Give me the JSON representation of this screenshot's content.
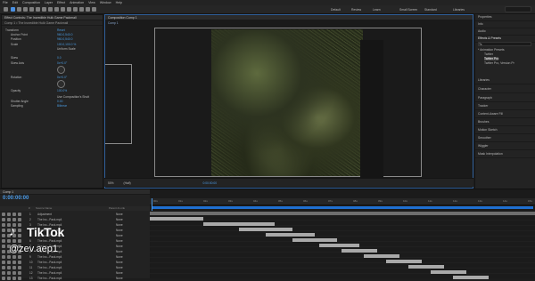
{
  "menu": [
    "File",
    "Edit",
    "Composition",
    "Layer",
    "Effect",
    "Animation",
    "View",
    "Window",
    "Help"
  ],
  "workspaces": [
    "Default",
    "Review",
    "Learn",
    "Small Screen",
    "Standard",
    "Libraries"
  ],
  "effect_controls": {
    "tab": "Effect Controls: The Incredible Hulk Game Packmall",
    "layer": "Comp 1 • The Incredible Hulk Game Packmall",
    "props": [
      {
        "label": "Transform",
        "value": "Reset"
      },
      {
        "label": "Anchor Point",
        "value": "960.0,540.0"
      },
      {
        "label": "Position",
        "value": "960.0,540.0"
      },
      {
        "label": "Scale",
        "value": "100.0,100.0 %"
      },
      {
        "label": "",
        "value": "Uniform Scale"
      },
      {
        "label": "Skew",
        "value": "0.0"
      },
      {
        "label": "Skew Axis",
        "value": "0x+0.0°"
      },
      {
        "label": "Rotation",
        "value": "0x+0.0°"
      },
      {
        "label": "Opacity",
        "value": "100.0%"
      },
      {
        "label": "",
        "value": "Use Composition's Shutt"
      },
      {
        "label": "Shutter Angle",
        "value": "0.00"
      },
      {
        "label": "Sampling",
        "value": "Bilinear"
      }
    ]
  },
  "composition": {
    "tab": "Composition Comp 1",
    "sub_tab": "Comp 1",
    "zoom": "50%",
    "quality": "(Half)",
    "timecode": "0:00:00:00"
  },
  "right_panel": {
    "items": [
      "Properties",
      "Info",
      "Audio",
      "Effects & Presets",
      "Libraries",
      "Character",
      "Paragraph",
      "Tracker",
      "Content-Aware Fill",
      "Brushes",
      "Motion Sketch",
      "Smoother",
      "Wiggler",
      "Mask Interpolation"
    ],
    "search": "Ts",
    "tree": [
      "* Animation Presets",
      "Twitter",
      "Twitter Pro",
      "Twitter Pro, Version Pr"
    ]
  },
  "timeline": {
    "tab": "Comp 1",
    "timecode": "0:00:00:00",
    "header": [
      "#",
      "Source Name",
      "Parent & Link"
    ],
    "layer_rows": [
      {
        "num": "1",
        "name": "Adjustment",
        "parent": "None"
      },
      {
        "num": "2",
        "name": "The Inc...Pack.mp4",
        "parent": "None"
      },
      {
        "num": "3",
        "name": "The Inc...Pack.mp4",
        "parent": "None"
      },
      {
        "num": "4",
        "name": "The Inc...Pack.mp4",
        "parent": "None"
      },
      {
        "num": "5",
        "name": "The Inc...Pack.mp4",
        "parent": "None"
      },
      {
        "num": "6",
        "name": "The Inc...Pack.mp4",
        "parent": "None"
      },
      {
        "num": "7",
        "name": "The Inc...Pack.mp4",
        "parent": "None"
      },
      {
        "num": "8",
        "name": "The Inc...Pack.mp4",
        "parent": "None"
      },
      {
        "num": "9",
        "name": "The Inc...Pack.mp4",
        "parent": "None"
      },
      {
        "num": "10",
        "name": "The Inc...Pack.mp4",
        "parent": "None"
      },
      {
        "num": "11",
        "name": "The Inc...Pack.mp4",
        "parent": "None"
      },
      {
        "num": "12",
        "name": "The Inc...Pack.mp4",
        "parent": "None"
      },
      {
        "num": "13",
        "name": "The Inc...Pack.mp4",
        "parent": "None"
      }
    ],
    "ruler_ticks": [
      "00s",
      "01s",
      "02s",
      "03s",
      "04s",
      "05s",
      "06s",
      "07s",
      "08s",
      "09s",
      "10s",
      "11s",
      "12s",
      "13s",
      "14s",
      "15s"
    ]
  },
  "watermark": {
    "brand": "TikTok",
    "handle": "@zev.aep1"
  },
  "colors": {
    "accent": "#4a90e2",
    "bar": "#a9a9a9",
    "background": "#1d1d1d"
  }
}
